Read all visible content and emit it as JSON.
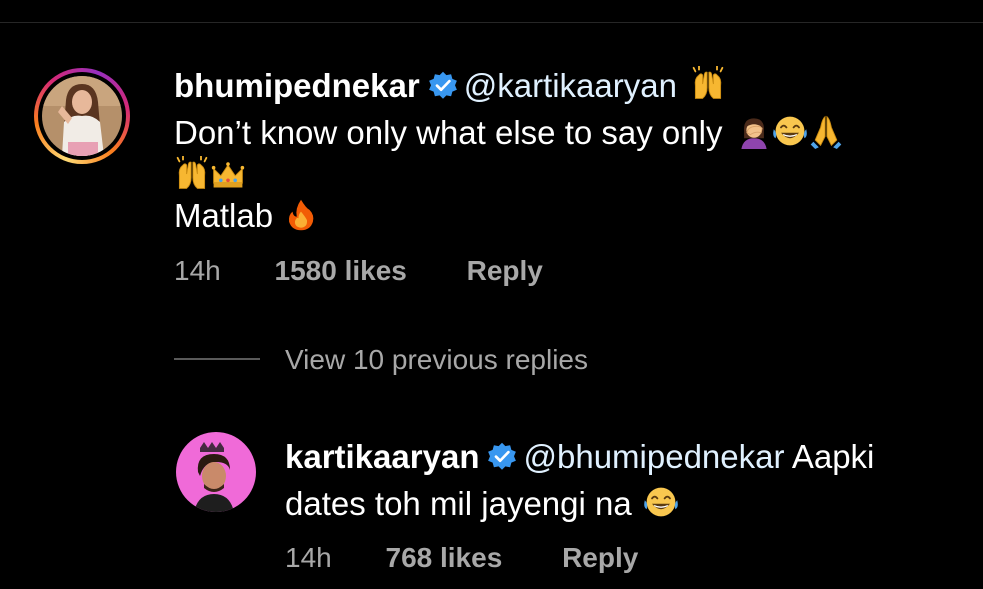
{
  "comment": {
    "username": "bhumipednekar",
    "mention": "@kartikaaryan",
    "line1": "Don’t know only what else to say only",
    "line3": "Matlab",
    "time": "14h",
    "likes": "1580 likes",
    "reply": "Reply",
    "emojis": {
      "after_mention": "raising-hands-icon",
      "line1": [
        "woman-facepalming-icon",
        "tears-of-joy-icon",
        "folded-hands-icon"
      ],
      "line2": [
        "raising-hands-icon",
        "crown-icon"
      ],
      "line3": "fire-icon"
    }
  },
  "view_replies": "View 10 previous replies",
  "reply": {
    "username": "kartikaaryan",
    "mention": "@bhumipednekar",
    "text_rest": "Aapki",
    "line2": "dates toh mil jayengi na",
    "time": "14h",
    "likes": "768 likes",
    "reply": "Reply",
    "emojis": {
      "line2": "tears-of-joy-icon"
    }
  },
  "colors": {
    "background": "#000000",
    "text": "#ffffff",
    "secondary": "#a8a8a8",
    "verified": "#3897f0",
    "reply_avatar_bg": "#f06ad8"
  }
}
